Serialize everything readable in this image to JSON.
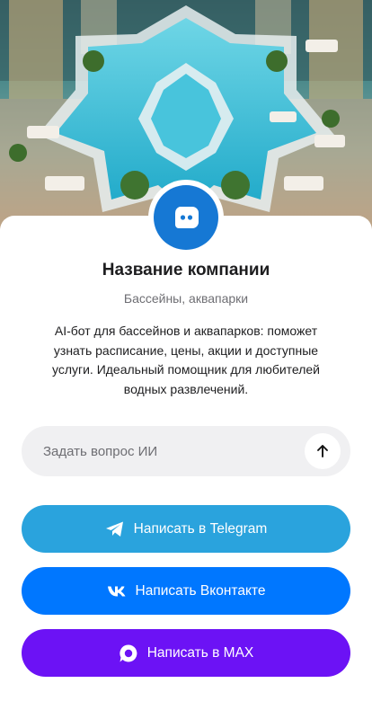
{
  "company": {
    "name": "Название компании",
    "category": "Бассейны, аквапарки",
    "description": "AI-бот для бассейнов и аквапарков: поможет узнать расписание, цены, акции и доступные услуги. Идеальный помощник для любителей водных развлечений.",
    "logo_icon": "chat-bot-icon",
    "logo_color": "#1678d4"
  },
  "ask": {
    "placeholder": "Задать вопрос ИИ",
    "send_icon": "arrow-up-icon"
  },
  "buttons": [
    {
      "label": "Написать в Telegram",
      "icon": "telegram-icon",
      "color": "#2aa3dd"
    },
    {
      "label": "Написать Вконтакте",
      "icon": "vk-icon",
      "color": "#0077ff"
    },
    {
      "label": "Написать в MAX",
      "icon": "max-icon",
      "color": "#6c12f5"
    }
  ]
}
